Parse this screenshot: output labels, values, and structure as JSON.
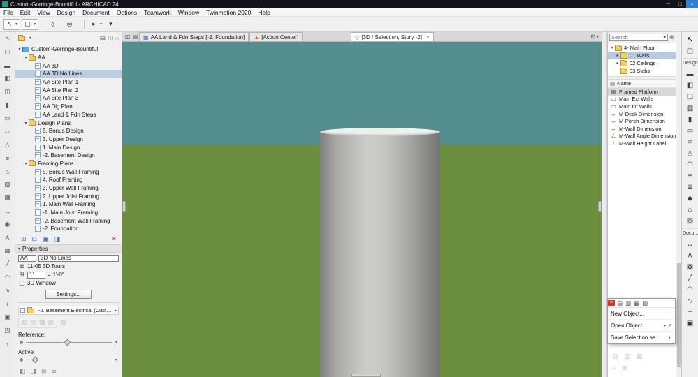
{
  "window": {
    "title": "Custom-Gorringe-Bountiful - ARCHICAD 24",
    "controls": {
      "minimize": "─",
      "maximize": "□",
      "close": "×"
    }
  },
  "menubar": [
    "File",
    "Edit",
    "View",
    "Design",
    "Document",
    "Options",
    "Teamwork",
    "Window",
    "Twinmotion 2020",
    "Help"
  ],
  "toolbar_groups": [
    {
      "name": "arrow-tool",
      "glyph": "↖",
      "caret": "▾",
      "boxed": true
    },
    {
      "name": "marquee-tool",
      "glyph": "▢",
      "caret": "▾",
      "boxed": true
    },
    {
      "name": "separator-1",
      "sep": true
    },
    {
      "name": "pen-tool",
      "glyph": "◊"
    },
    {
      "name": "orbit-tool",
      "glyph": "◎"
    },
    {
      "name": "separator-2",
      "sep": true
    },
    {
      "name": "explore-tool",
      "glyph": "▸",
      "caret": "▾"
    },
    {
      "name": "more-tools",
      "glyph": "▾"
    }
  ],
  "left_rail": [
    {
      "name": "arrow-icon",
      "glyph": "↖"
    },
    {
      "name": "marquee-icon",
      "glyph": "▢"
    },
    {
      "name": "wall-icon",
      "glyph": "▬"
    },
    {
      "name": "door-icon",
      "glyph": "◧"
    },
    {
      "name": "window-icon",
      "glyph": "◫"
    },
    {
      "name": "column-icon",
      "glyph": "▮"
    },
    {
      "name": "beam-icon",
      "glyph": "▭"
    },
    {
      "name": "slab-icon",
      "glyph": "▱"
    },
    {
      "name": "roof-icon",
      "glyph": "△"
    },
    {
      "name": "stair-icon",
      "glyph": "≡"
    },
    {
      "name": "object-icon",
      "glyph": "⌂"
    },
    {
      "name": "zone-icon",
      "glyph": "▨"
    },
    {
      "name": "mesh-icon",
      "glyph": "▩"
    },
    {
      "name": "dimension-icon",
      "glyph": "↔"
    },
    {
      "name": "camera-icon",
      "glyph": "◉"
    },
    {
      "name": "text-icon",
      "glyph": "A"
    },
    {
      "name": "fill-icon",
      "glyph": "▦"
    },
    {
      "name": "line-icon",
      "glyph": "╱"
    },
    {
      "name": "arc-icon",
      "glyph": "◠"
    },
    {
      "name": "spline-icon",
      "glyph": "∿"
    },
    {
      "name": "hotspot-icon",
      "glyph": "+"
    },
    {
      "name": "figure-icon",
      "glyph": "▣"
    },
    {
      "name": "drawing-icon",
      "glyph": "◳"
    },
    {
      "name": "section-icon",
      "glyph": "↕"
    }
  ],
  "navigator": {
    "tree": [
      {
        "label": "Custom-Gorringe-Bountiful",
        "depth": 0,
        "project": true,
        "caret": "▾"
      },
      {
        "label": "AA",
        "depth": 1,
        "folder": true,
        "caret": "▾"
      },
      {
        "label": "AA 3D",
        "depth": 2,
        "view": true
      },
      {
        "label": "AA 3D No Lines",
        "depth": 2,
        "view": true,
        "selected": true
      },
      {
        "label": "AA Site Plan 1",
        "depth": 2,
        "view": true
      },
      {
        "label": "AA Site Plan 2",
        "depth": 2,
        "view": true
      },
      {
        "label": "AA Site Plan 3",
        "depth": 2,
        "view": true
      },
      {
        "label": "AA Dig Plan",
        "depth": 2,
        "view": true
      },
      {
        "label": "AA Land & Fdn Steps",
        "depth": 2,
        "view": true
      },
      {
        "label": "Design Plans",
        "depth": 1,
        "folder": true,
        "caret": "▾"
      },
      {
        "label": "5. Bonus Design",
        "depth": 2,
        "view": true
      },
      {
        "label": "3. Upper Design",
        "depth": 2,
        "view": true
      },
      {
        "label": "1. Main Design",
        "depth": 2,
        "view": true
      },
      {
        "label": "-2. Basement Design",
        "depth": 2,
        "view": true
      },
      {
        "label": "Framing Plans",
        "depth": 1,
        "folder": true,
        "caret": "▾"
      },
      {
        "label": "5. Bonus Wall Framing",
        "depth": 2,
        "view": true
      },
      {
        "label": "4. Roof Framing",
        "depth": 2,
        "view": true
      },
      {
        "label": "3. Upper Wall Framing",
        "depth": 2,
        "view": true
      },
      {
        "label": "2. Upper Joist Framing",
        "depth": 2,
        "view": true
      },
      {
        "label": "1. Main Wall Framing",
        "depth": 2,
        "view": true
      },
      {
        "label": "-1. Main Joist Framing",
        "depth": 2,
        "view": true
      },
      {
        "label": "-2. Basement Wall Framing",
        "depth": 2,
        "view": true
      },
      {
        "label": "-2. Foundation",
        "depth": 2,
        "view": true
      }
    ],
    "actions": [
      {
        "name": "new-folder-button",
        "glyph": "⊞"
      },
      {
        "name": "clone-folder-button",
        "glyph": "⊟"
      },
      {
        "name": "save-view-button",
        "glyph": "▣"
      },
      {
        "name": "view-settings-button",
        "glyph": "◨"
      }
    ],
    "delete_glyph": "×",
    "toolbar_icons": [
      {
        "name": "project-map-icon",
        "glyph": "▤"
      },
      {
        "name": "view-map-icon",
        "glyph": "◫"
      },
      {
        "name": "layout-book-icon",
        "glyph": "⌂"
      }
    ],
    "chooser_caret": "▾"
  },
  "properties": {
    "title": "Properties",
    "caret": "▾",
    "view_id": "AA",
    "view_name": "3D No Lines",
    "layer_combination": "11-05 3D Tours",
    "scale": "1'",
    "equals": "=",
    "scale_value": "1'-0\"",
    "window_type": "3D Window",
    "settings_button": "Settings...",
    "hotlink": "-2. Basement Electrical (Custom-Gorrin...",
    "hotlink_arrow": "▸",
    "disabled_icons": [
      {
        "glyph": "▤"
      },
      {
        "glyph": "▥"
      },
      {
        "glyph": "▦"
      },
      {
        "glyph": "▧"
      }
    ],
    "disabled_extra": "▨",
    "reference_label": "Reference:",
    "active_label": "Active:",
    "slider_caret": "▾",
    "bottom_icons": [
      {
        "glyph": "◧"
      },
      {
        "glyph": "◨"
      },
      {
        "glyph": "⊞"
      },
      {
        "glyph": "≣"
      }
    ]
  },
  "tabbar": {
    "left_icons": [
      {
        "name": "tab-list-icon",
        "glyph": "◫"
      },
      {
        "name": "tab-tile-icon",
        "glyph": "▤"
      }
    ],
    "tabs": [
      {
        "label": "AA Land & Fdn Steps [-2. Foundation]",
        "icon": "▦"
      },
      {
        "label": "[Action Center]",
        "icon": "▲"
      },
      {
        "label": "[3D / Selection, Story -2]",
        "icon": "◇",
        "close": "×"
      }
    ],
    "overview_glyph": "⊡",
    "overview_caret": "▾"
  },
  "viewport": {
    "sky_color": "#548e8e",
    "ground_color": "#6b8f3e",
    "object": "cylinder",
    "cylinder_color": "#c6c6c4"
  },
  "right_panel": {
    "search_placeholder": "Search",
    "search_caret": "▾",
    "gear_glyph": "⊛",
    "tree": [
      {
        "label": "4- Main Floor",
        "depth": 0,
        "folder": true,
        "caret": "▾"
      },
      {
        "label": "01 Walls",
        "depth": 1,
        "folder": true,
        "caret": "▸",
        "selected": true
      },
      {
        "label": "02 Ceilings",
        "depth": 1,
        "folder": true,
        "caret": "▸"
      },
      {
        "label": "03 Slabs",
        "depth": 1,
        "folder": true,
        "caret": ""
      }
    ],
    "list_header": "Name",
    "header_glyph": "▤",
    "items": [
      {
        "label": "Framed Platform",
        "glyph": "▦",
        "color": "#666666",
        "selected": true
      },
      {
        "label": "Main Ext Walls",
        "glyph": "▭",
        "color": "#666666"
      },
      {
        "label": "Main Int Walls",
        "glyph": "▭",
        "color": "#666666"
      },
      {
        "label": "M-Deck Dimension",
        "glyph": "↔",
        "color": "#2e8b2e"
      },
      {
        "label": "M-Porch Dimension",
        "glyph": "↔",
        "color": "#2e8b2e"
      },
      {
        "label": "M-Wall Dimension",
        "glyph": "↔",
        "color": "#2e8b2e"
      },
      {
        "label": "M-Wall Angle Dimension",
        "glyph": "∠",
        "color": "#c9a227"
      },
      {
        "label": "M-Wall Height Label",
        "glyph": "↕",
        "color": "#2e8b2e"
      }
    ]
  },
  "toolbox": {
    "select_tools": [
      {
        "name": "arrow-tool-icon",
        "glyph": "↖"
      },
      {
        "name": "marquee-tool-icon",
        "glyph": "▢"
      }
    ],
    "design_label": "Design",
    "design_tools": [
      {
        "name": "wall-tool-icon",
        "glyph": "▬"
      },
      {
        "name": "door-tool-icon",
        "glyph": "◧"
      },
      {
        "name": "window-tool-icon",
        "glyph": "◫"
      },
      {
        "name": "curtain-wall-tool-icon",
        "glyph": "▥"
      },
      {
        "name": "column-tool-icon",
        "glyph": "▮"
      },
      {
        "name": "beam-tool-icon",
        "glyph": "▭"
      },
      {
        "name": "slab-tool-icon",
        "glyph": "▱"
      },
      {
        "name": "roof-tool-icon",
        "glyph": "△"
      },
      {
        "name": "shell-tool-icon",
        "glyph": "◠"
      },
      {
        "name": "stair-tool-icon",
        "glyph": "≡"
      },
      {
        "name": "railing-tool-icon",
        "glyph": "≣"
      },
      {
        "name": "morph-tool-icon",
        "glyph": "◆"
      },
      {
        "name": "object-tool-icon",
        "glyph": "⌂"
      },
      {
        "name": "zone-tool-icon",
        "glyph": "▨"
      }
    ],
    "document_label": "Docu...",
    "document_tools": [
      {
        "name": "dimension-tool-icon",
        "glyph": "↔"
      },
      {
        "name": "text-tool-icon",
        "glyph": "A"
      },
      {
        "name": "fill-tool-icon",
        "glyph": "▩"
      },
      {
        "name": "line-tool-icon",
        "glyph": "╱"
      },
      {
        "name": "arc-tool-icon",
        "glyph": "◠"
      },
      {
        "name": "spline-tool-icon",
        "glyph": "∿"
      },
      {
        "name": "hotspot-tool-icon",
        "glyph": "+"
      },
      {
        "name": "figure-tool-icon",
        "glyph": "▣"
      }
    ]
  },
  "palette": {
    "close_glyph": "×",
    "header_icons": [
      {
        "name": "new-library-part-icon",
        "glyph": "▤"
      },
      {
        "name": "open-library-part-icon",
        "glyph": "▥"
      },
      {
        "name": "save-library-part-icon",
        "glyph": "▦"
      },
      {
        "name": "library-manager-icon",
        "glyph": "▧"
      }
    ],
    "menu": [
      {
        "label": "New Object...",
        "caret": "",
        "extra": ""
      },
      {
        "label": "Open Object...",
        "caret": "▾",
        "extra": "↗"
      },
      {
        "label": "Save Selection as...",
        "caret": "▾",
        "extra": ""
      }
    ],
    "disabled_row1": [
      {
        "glyph": "▤"
      },
      {
        "glyph": "▥"
      },
      {
        "glyph": "▦"
      }
    ],
    "disabled_row2": [
      {
        "glyph": "≡"
      },
      {
        "glyph": "≣"
      }
    ]
  }
}
